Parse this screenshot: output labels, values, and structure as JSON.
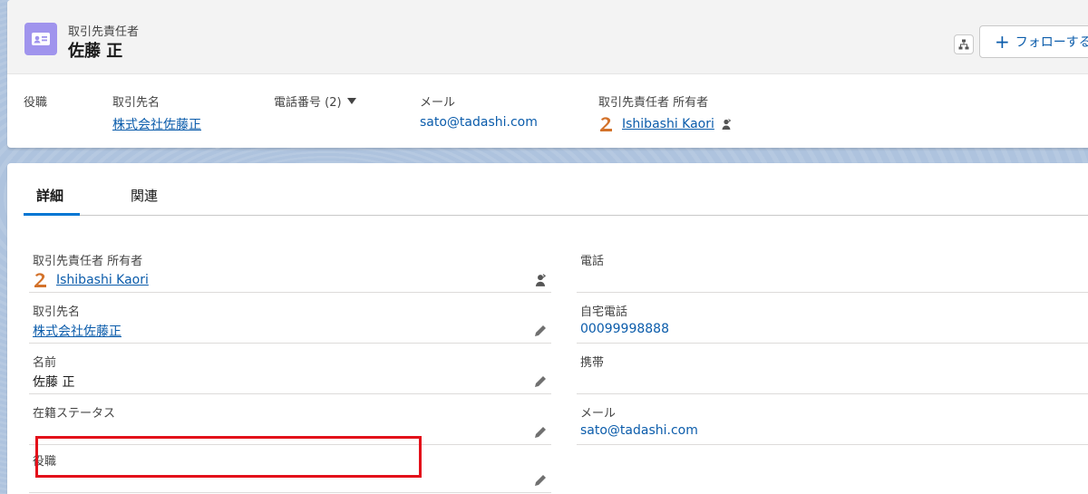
{
  "header": {
    "object_type": "取引先責任者",
    "record_name": "佐藤 正",
    "follow_label": "フォローする",
    "highlights": [
      {
        "label": "役職",
        "value": ""
      },
      {
        "label": "取引先名",
        "value": "株式会社佐藤正"
      },
      {
        "label": "電話番号 (2)",
        "value": ""
      },
      {
        "label": "メール",
        "value": "sato@tadashi.com"
      },
      {
        "label": "取引先責任者 所有者",
        "value": "Ishibashi Kaori"
      }
    ]
  },
  "tabs": [
    {
      "label": "詳細",
      "active": true
    },
    {
      "label": "関連",
      "active": false
    }
  ],
  "fields_left": [
    {
      "label": "取引先責任者 所有者",
      "value": "Ishibashi Kaori"
    },
    {
      "label": "取引先名",
      "value": "株式会社佐藤正"
    },
    {
      "label": "名前",
      "value": "佐藤 正"
    },
    {
      "label": "在籍ステータス",
      "value": ""
    },
    {
      "label": "役職",
      "value": ""
    }
  ],
  "fields_right": [
    {
      "label": "電話",
      "value": ""
    },
    {
      "label": "自宅電話",
      "value": "00099998888"
    },
    {
      "label": "携帯",
      "value": ""
    },
    {
      "label": "メール",
      "value": "sato@tadashi.com"
    }
  ],
  "colors": {
    "brand_blue": "#0176d3",
    "link": "#0b5cab",
    "contact_icon_bg": "#a094ed",
    "highlight_red": "#e3101a"
  }
}
